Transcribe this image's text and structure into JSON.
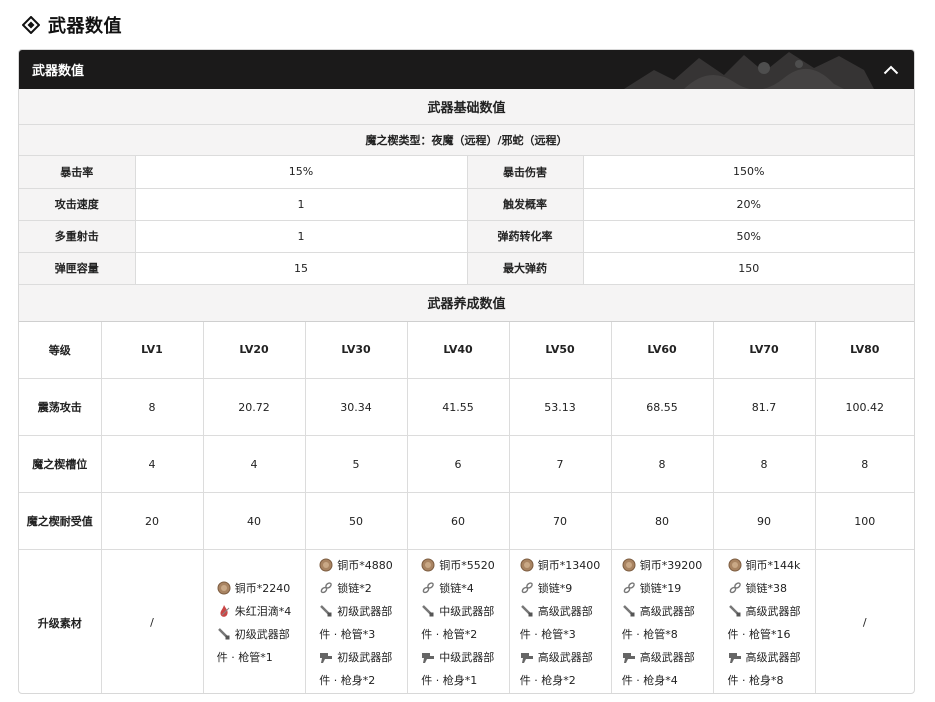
{
  "heading": "武器数值",
  "panel": {
    "title": "武器数值"
  },
  "basic": {
    "title": "武器基础数值",
    "subtype": "魔之楔类型：夜魔（远程）/邪蛇（远程）",
    "rows": [
      {
        "l1": "暴击率",
        "v1": "15%",
        "l2": "暴击伤害",
        "v2": "150%"
      },
      {
        "l1": "攻击速度",
        "v1": "1",
        "l2": "触发概率",
        "v2": "20%"
      },
      {
        "l1": "多重射击",
        "v1": "1",
        "l2": "弹药转化率",
        "v2": "50%"
      },
      {
        "l1": "弹匣容量",
        "v1": "15",
        "l2": "最大弹药",
        "v2": "150"
      }
    ]
  },
  "growth": {
    "title": "武器养成数值",
    "header": [
      "等级",
      "LV1",
      "LV20",
      "LV30",
      "LV40",
      "LV50",
      "LV60",
      "LV70",
      "LV80"
    ],
    "rows": [
      [
        "震荡攻击",
        "8",
        "20.72",
        "30.34",
        "41.55",
        "53.13",
        "68.55",
        "81.7",
        "100.42"
      ],
      [
        "魔之楔槽位",
        "4",
        "4",
        "5",
        "6",
        "7",
        "8",
        "8",
        "8"
      ],
      [
        "魔之楔耐受值",
        "20",
        "40",
        "50",
        "60",
        "70",
        "80",
        "90",
        "100"
      ]
    ],
    "materials_label": "升级素材",
    "materials": {
      "lv1": "/",
      "lv20": [
        {
          "icon": "coin-icon",
          "line1": "铜币*2240",
          "line2": ""
        },
        {
          "icon": "red-drop-icon",
          "line1": "朱红泪滴*4",
          "line2": ""
        },
        {
          "icon": "barrel-part-icon",
          "line1": "初级武器部",
          "line2": "件 · 枪管*1"
        }
      ],
      "lv30": [
        {
          "icon": "coin-icon",
          "line1": "铜币*4880",
          "line2": ""
        },
        {
          "icon": "chain-icon",
          "line1": "锁链*2",
          "line2": ""
        },
        {
          "icon": "barrel-part-icon",
          "line1": "初级武器部",
          "line2": "件 · 枪管*3"
        },
        {
          "icon": "body-part-icon",
          "line1": "初级武器部",
          "line2": "件 · 枪身*2"
        }
      ],
      "lv40": [
        {
          "icon": "coin-icon",
          "line1": "铜币*5520",
          "line2": ""
        },
        {
          "icon": "chain-icon",
          "line1": "锁链*4",
          "line2": ""
        },
        {
          "icon": "barrel-part-icon",
          "line1": "中级武器部",
          "line2": "件 · 枪管*2"
        },
        {
          "icon": "body-part-icon",
          "line1": "中级武器部",
          "line2": "件 · 枪身*1"
        }
      ],
      "lv50": [
        {
          "icon": "coin-icon",
          "line1": "铜币*13400",
          "line2": ""
        },
        {
          "icon": "chain-icon",
          "line1": "锁链*9",
          "line2": ""
        },
        {
          "icon": "barrel-part-icon",
          "line1": "高级武器部",
          "line2": "件 · 枪管*3"
        },
        {
          "icon": "body-part-icon",
          "line1": "高级武器部",
          "line2": "件 · 枪身*2"
        }
      ],
      "lv60": [
        {
          "icon": "coin-icon",
          "line1": "铜币*39200",
          "line2": ""
        },
        {
          "icon": "chain-icon",
          "line1": "锁链*19",
          "line2": ""
        },
        {
          "icon": "barrel-part-icon",
          "line1": "高级武器部",
          "line2": "件 · 枪管*8"
        },
        {
          "icon": "body-part-icon",
          "line1": "高级武器部",
          "line2": "件 · 枪身*4"
        }
      ],
      "lv70": [
        {
          "icon": "coin-icon",
          "line1": "铜币*144k",
          "line2": ""
        },
        {
          "icon": "chain-icon",
          "line1": "锁链*38",
          "line2": ""
        },
        {
          "icon": "barrel-part-icon",
          "line1": "高级武器部",
          "line2": "件 · 枪管*16"
        },
        {
          "icon": "body-part-icon",
          "line1": "高级武器部",
          "line2": "件 · 枪身*8"
        }
      ],
      "lv80": "/"
    }
  },
  "colors": {
    "header_bg": "#1b1a1a",
    "label_bg": "#f5f4f4",
    "border": "#dcdcdc"
  }
}
